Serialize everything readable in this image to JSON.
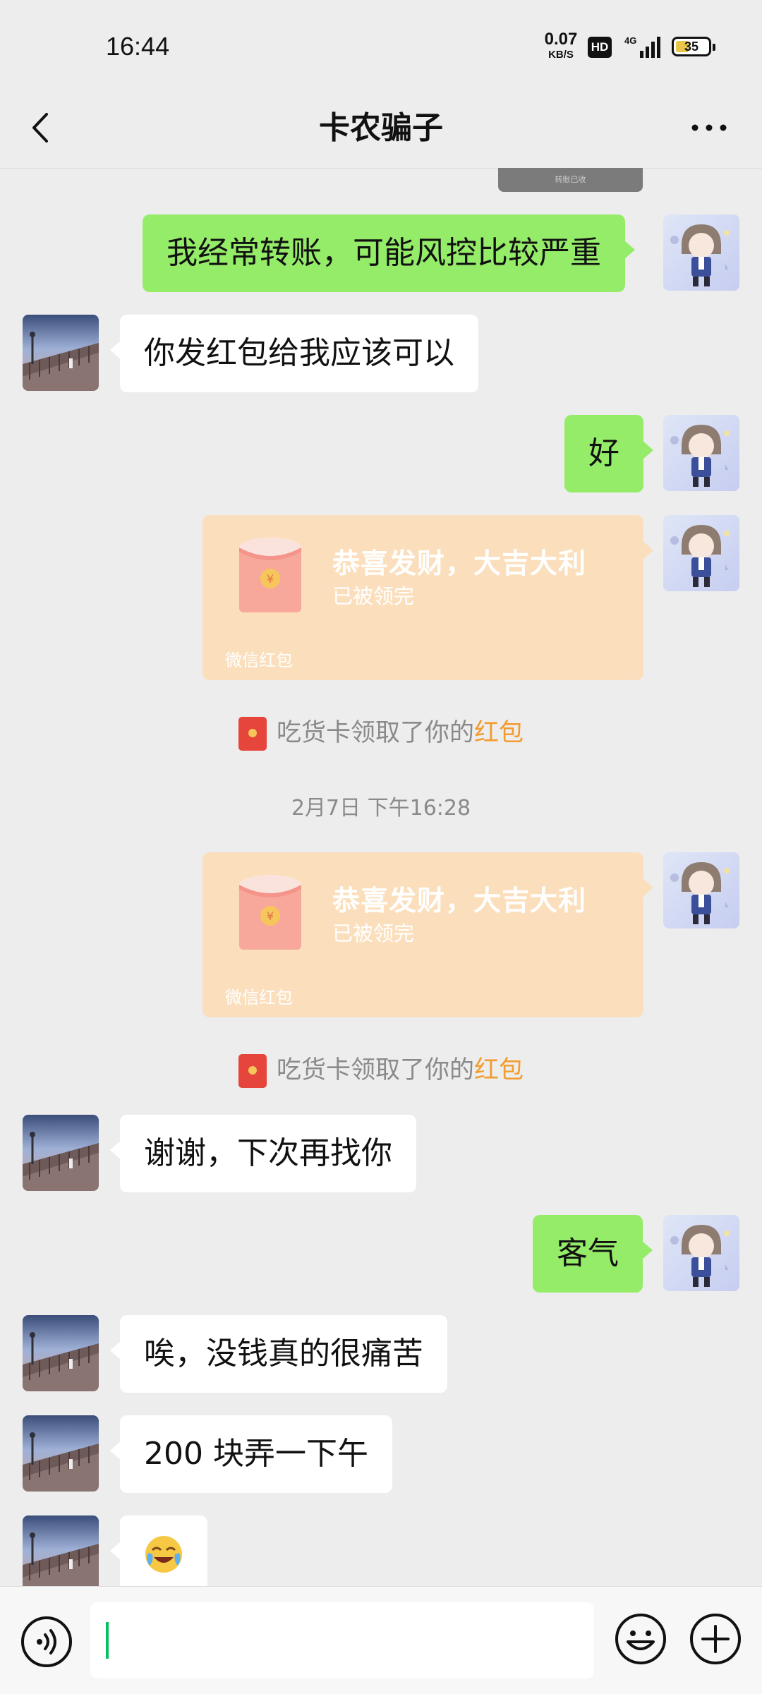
{
  "status_bar": {
    "time": "16:44",
    "net_speed_value": "0.07",
    "net_speed_unit": "KB/S",
    "hd_label": "HD",
    "network_label": "4G",
    "battery_level": "35"
  },
  "header": {
    "back_icon": "chevron-left-icon",
    "title": "卡农骗子",
    "more_icon": "more-dots-icon"
  },
  "chat": {
    "partial_card_text": "转账已收",
    "messages": [
      {
        "side": "right",
        "text": "我经常转账，可能风控比较严重"
      },
      {
        "side": "left",
        "text": "你发红包给我应该可以"
      },
      {
        "side": "right",
        "text": "好"
      }
    ],
    "red_packet_1": {
      "greeting": "恭喜发财，大吉大利",
      "status": "已被领完",
      "brand": "微信红包"
    },
    "system_1": {
      "text": "吃货卡领取了你的",
      "highlight": "红包"
    },
    "timestamp": "2月7日 下午16:28",
    "red_packet_2": {
      "greeting": "恭喜发财，大吉大利",
      "status": "已被领完",
      "brand": "微信红包"
    },
    "system_2": {
      "text": "吃货卡领取了你的",
      "highlight": "红包"
    },
    "messages_after": [
      {
        "side": "left",
        "text": "谢谢，下次再找你"
      },
      {
        "side": "right",
        "text": "客气"
      },
      {
        "side": "left",
        "text": "唉，没钱真的很痛苦"
      },
      {
        "side": "left",
        "text": "200 块弄一下午"
      },
      {
        "side": "left",
        "emoji": "face-with-tears-of-joy-icon"
      }
    ]
  },
  "bottom_bar": {
    "voice_icon": "voice-input-icon",
    "input_value": "",
    "emoji_icon": "emoji-icon",
    "plus_icon": "plus-icon"
  },
  "colors": {
    "background": "#ededed",
    "sent_bubble": "#95ec69",
    "received_bubble": "#ffffff",
    "red_packet": "#fbdfbd",
    "highlight": "#f39b2d",
    "cursor": "#07c160"
  }
}
